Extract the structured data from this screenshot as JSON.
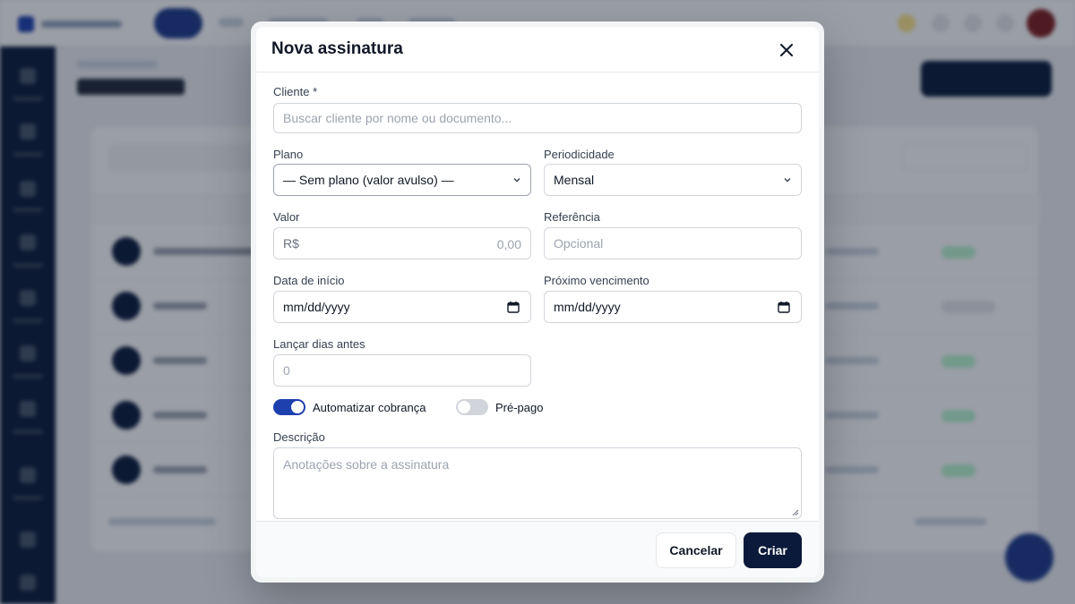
{
  "modal": {
    "title": "Nova assinatura",
    "close_icon": "close-icon"
  },
  "form": {
    "cliente": {
      "label": "Cliente *",
      "placeholder": "Buscar cliente por nome ou documento..."
    },
    "plano": {
      "label": "Plano",
      "value": "— Sem plano (valor avulso) —"
    },
    "periodicidade": {
      "label": "Periodicidade",
      "value": "Mensal"
    },
    "valor": {
      "label": "Valor",
      "prefix": "R$",
      "placeholder": "0,00"
    },
    "referencia": {
      "label": "Referência",
      "placeholder": "Opcional"
    },
    "data_inicio": {
      "label": "Data de início",
      "value": "mm/dd/yyyy"
    },
    "proximo_vencimento": {
      "label": "Próximo vencimento",
      "value": "mm/dd/yyyy"
    },
    "lancar_dias": {
      "label": "Lançar dias antes",
      "placeholder": "0"
    },
    "toggles": [
      {
        "label": "Automatizar cobrança",
        "on": true
      },
      {
        "label": "Pré-pago",
        "on": false
      }
    ],
    "descricao": {
      "label": "Descrição",
      "placeholder": "Anotações sobre a assinatura"
    }
  },
  "footer": {
    "cancel_label": "Cancelar",
    "submit_label": "Criar"
  },
  "colors": {
    "primary": "#0b1a3a",
    "toggle_on": "#1e40af",
    "toggle_off": "#d1d5db"
  }
}
